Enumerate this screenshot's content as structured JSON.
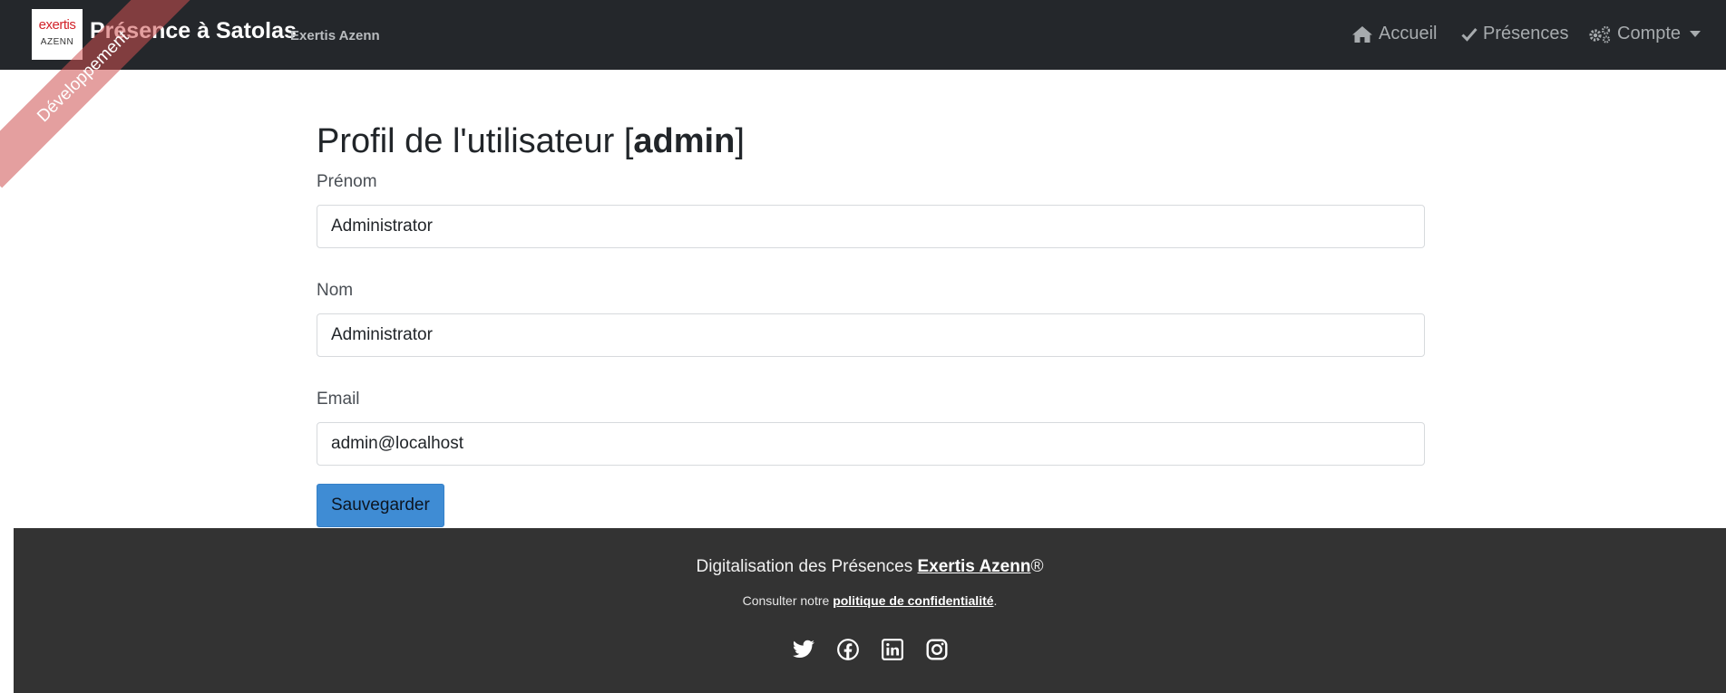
{
  "navbar": {
    "logo": {
      "line1": "exertis",
      "line2": "AZENN"
    },
    "brand": "Présence à Satolas",
    "brand_sub": "Exertis Azenn",
    "items": [
      {
        "label": "Accueil",
        "icon": "home-icon"
      },
      {
        "label": "Présences",
        "icon": "check-icon"
      },
      {
        "label": "Compte",
        "icon": "cogs-icon"
      }
    ]
  },
  "ribbon": {
    "label": "Développement"
  },
  "page": {
    "title_prefix": "Profil de l'utilisateur [",
    "title_user": "admin",
    "title_suffix": "]"
  },
  "form": {
    "first_name": {
      "label": "Prénom",
      "value": "Administrator"
    },
    "last_name": {
      "label": "Nom",
      "value": "Administrator"
    },
    "email": {
      "label": "Email",
      "value": "admin@localhost"
    },
    "save_label": "Sauvegarder"
  },
  "footer": {
    "line1_text": "Digitalisation des Présences ",
    "line1_link": "Exertis Azenn",
    "line1_suffix": "®",
    "line2_text": "Consulter notre ",
    "line2_link": "politique de confidentialité",
    "line2_suffix": ".",
    "social_icons": [
      "twitter-icon",
      "facebook-icon",
      "linkedin-icon",
      "instagram-icon"
    ]
  },
  "colors": {
    "navbar_bg": "#24272b",
    "footer_bg": "#333333",
    "button_bg": "#3f8cd4",
    "ribbon": "#cd5050",
    "logo_red": "#d2232a"
  }
}
